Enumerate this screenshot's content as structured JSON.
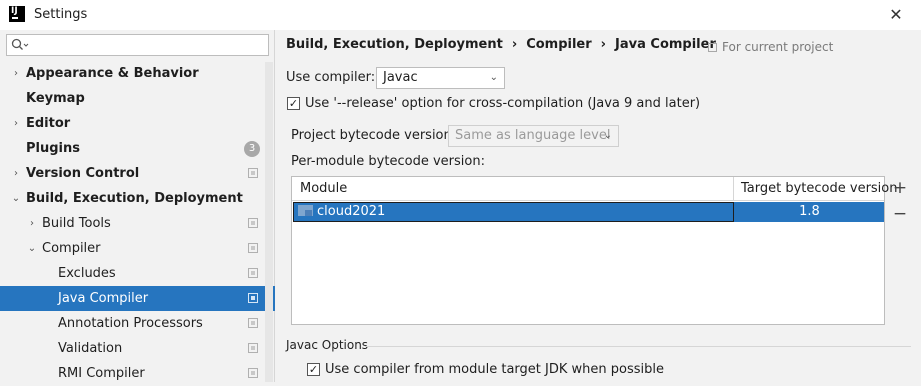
{
  "window": {
    "title": "Settings",
    "close_glyph": "✕",
    "logo_text": "IJ"
  },
  "sidebar": {
    "search_placeholder": "",
    "items": [
      {
        "label": "Appearance & Behavior",
        "bold": true,
        "arrow": "›"
      },
      {
        "label": "Keymap",
        "bold": true
      },
      {
        "label": "Editor",
        "bold": true,
        "arrow": "›"
      },
      {
        "label": "Plugins",
        "bold": true,
        "badge": "3"
      },
      {
        "label": "Version Control",
        "bold": true,
        "arrow": "›"
      },
      {
        "label": "Build, Execution, Deployment",
        "bold": true,
        "arrow": "⌄"
      },
      {
        "label": "Build Tools",
        "arrow": "›"
      },
      {
        "label": "Compiler",
        "arrow": "⌄"
      },
      {
        "label": "Excludes"
      },
      {
        "label": "Java Compiler",
        "selected": true
      },
      {
        "label": "Annotation Processors"
      },
      {
        "label": "Validation"
      },
      {
        "label": "RMI Compiler"
      }
    ]
  },
  "breadcrumb": [
    "Build, Execution, Deployment",
    "Compiler",
    "Java Compiler"
  ],
  "breadcrumb_sep": "›",
  "scope_note": "For current project",
  "use_compiler": {
    "label": "Use compiler:",
    "value": "Javac"
  },
  "release_option": {
    "label": "Use '--release' option for cross-compilation (Java 9 and later)",
    "checked": true
  },
  "project_bytecode": {
    "label": "Project bytecode version:",
    "placeholder": "Same as language level"
  },
  "per_module": {
    "label": "Per-module bytecode version:",
    "columns": [
      "Module",
      "Target bytecode version"
    ],
    "rows": [
      {
        "module": "cloud2021",
        "target": "1.8"
      }
    ],
    "add_glyph": "+",
    "remove_glyph": "−"
  },
  "javac_options": {
    "section_label": "Javac Options",
    "use_module_jdk": {
      "label": "Use compiler from module target JDK when possible",
      "checked": true
    }
  },
  "check_glyph": "✓",
  "dropdown_glyph": "⌄",
  "colors": {
    "selection": "#2675bf",
    "background": "#f2f2f2"
  }
}
